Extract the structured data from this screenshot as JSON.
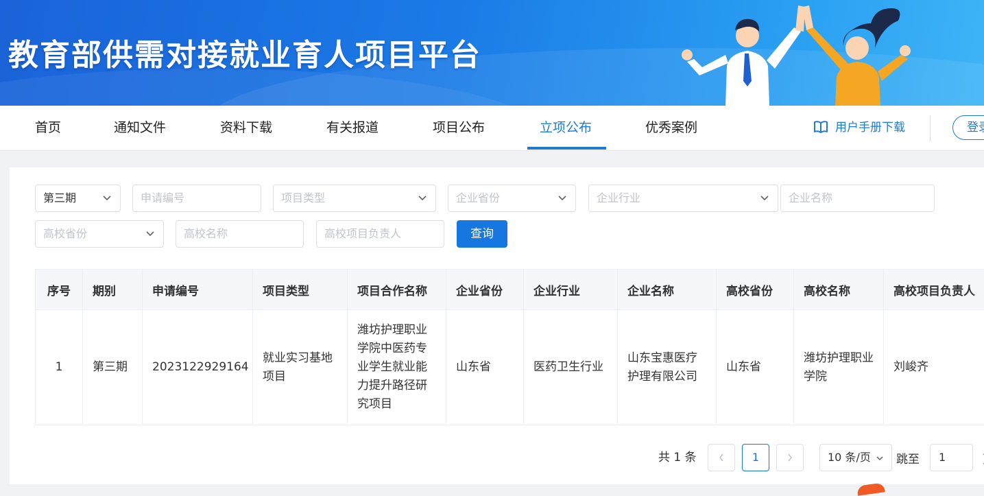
{
  "banner": {
    "title": "教育部供需对接就业育人项目平台"
  },
  "nav": {
    "items": [
      "首页",
      "通知文件",
      "资料下载",
      "有关报道",
      "项目公布",
      "立项公布",
      "优秀案例"
    ],
    "active": "立项公布",
    "manual_label": "用户手册下载",
    "login_label": "登录"
  },
  "filters": {
    "period_value": "第三期",
    "application_no_placeholder": "申请编号",
    "project_type_placeholder": "项目类型",
    "enterprise_province_placeholder": "企业省份",
    "enterprise_industry_placeholder": "企业行业",
    "enterprise_name_placeholder": "企业名称",
    "university_province_placeholder": "高校省份",
    "university_name_placeholder": "高校名称",
    "university_leader_placeholder": "高校项目负责人",
    "query_label": "查询"
  },
  "table": {
    "headers": [
      "序号",
      "期别",
      "申请编号",
      "项目类型",
      "项目合作名称",
      "企业省份",
      "企业行业",
      "企业名称",
      "高校省份",
      "高校名称",
      "高校项目负责人"
    ],
    "rows": [
      [
        "1",
        "第三期",
        "2023122929164",
        "就业实习基地项目",
        "潍坊护理职业学院中医药专业学生就业能力提升路径研究项目",
        "山东省",
        "医药卫生行业",
        "山东宝惠医疗护理有限公司",
        "山东省",
        "潍坊护理职业学院",
        "刘峻齐"
      ]
    ]
  },
  "pagination": {
    "total_label": "共 1 条",
    "prev_icon": "chevron-left-icon",
    "next_icon": "chevron-right-icon",
    "current_page": "1",
    "page_size_label": "10 条/页",
    "jump_label": "跳至",
    "jump_value": "1",
    "jump_tail": "页"
  },
  "colors": {
    "accent": "#1f7ad6",
    "button": "#1677e0",
    "banner": "#1a7ae6"
  }
}
